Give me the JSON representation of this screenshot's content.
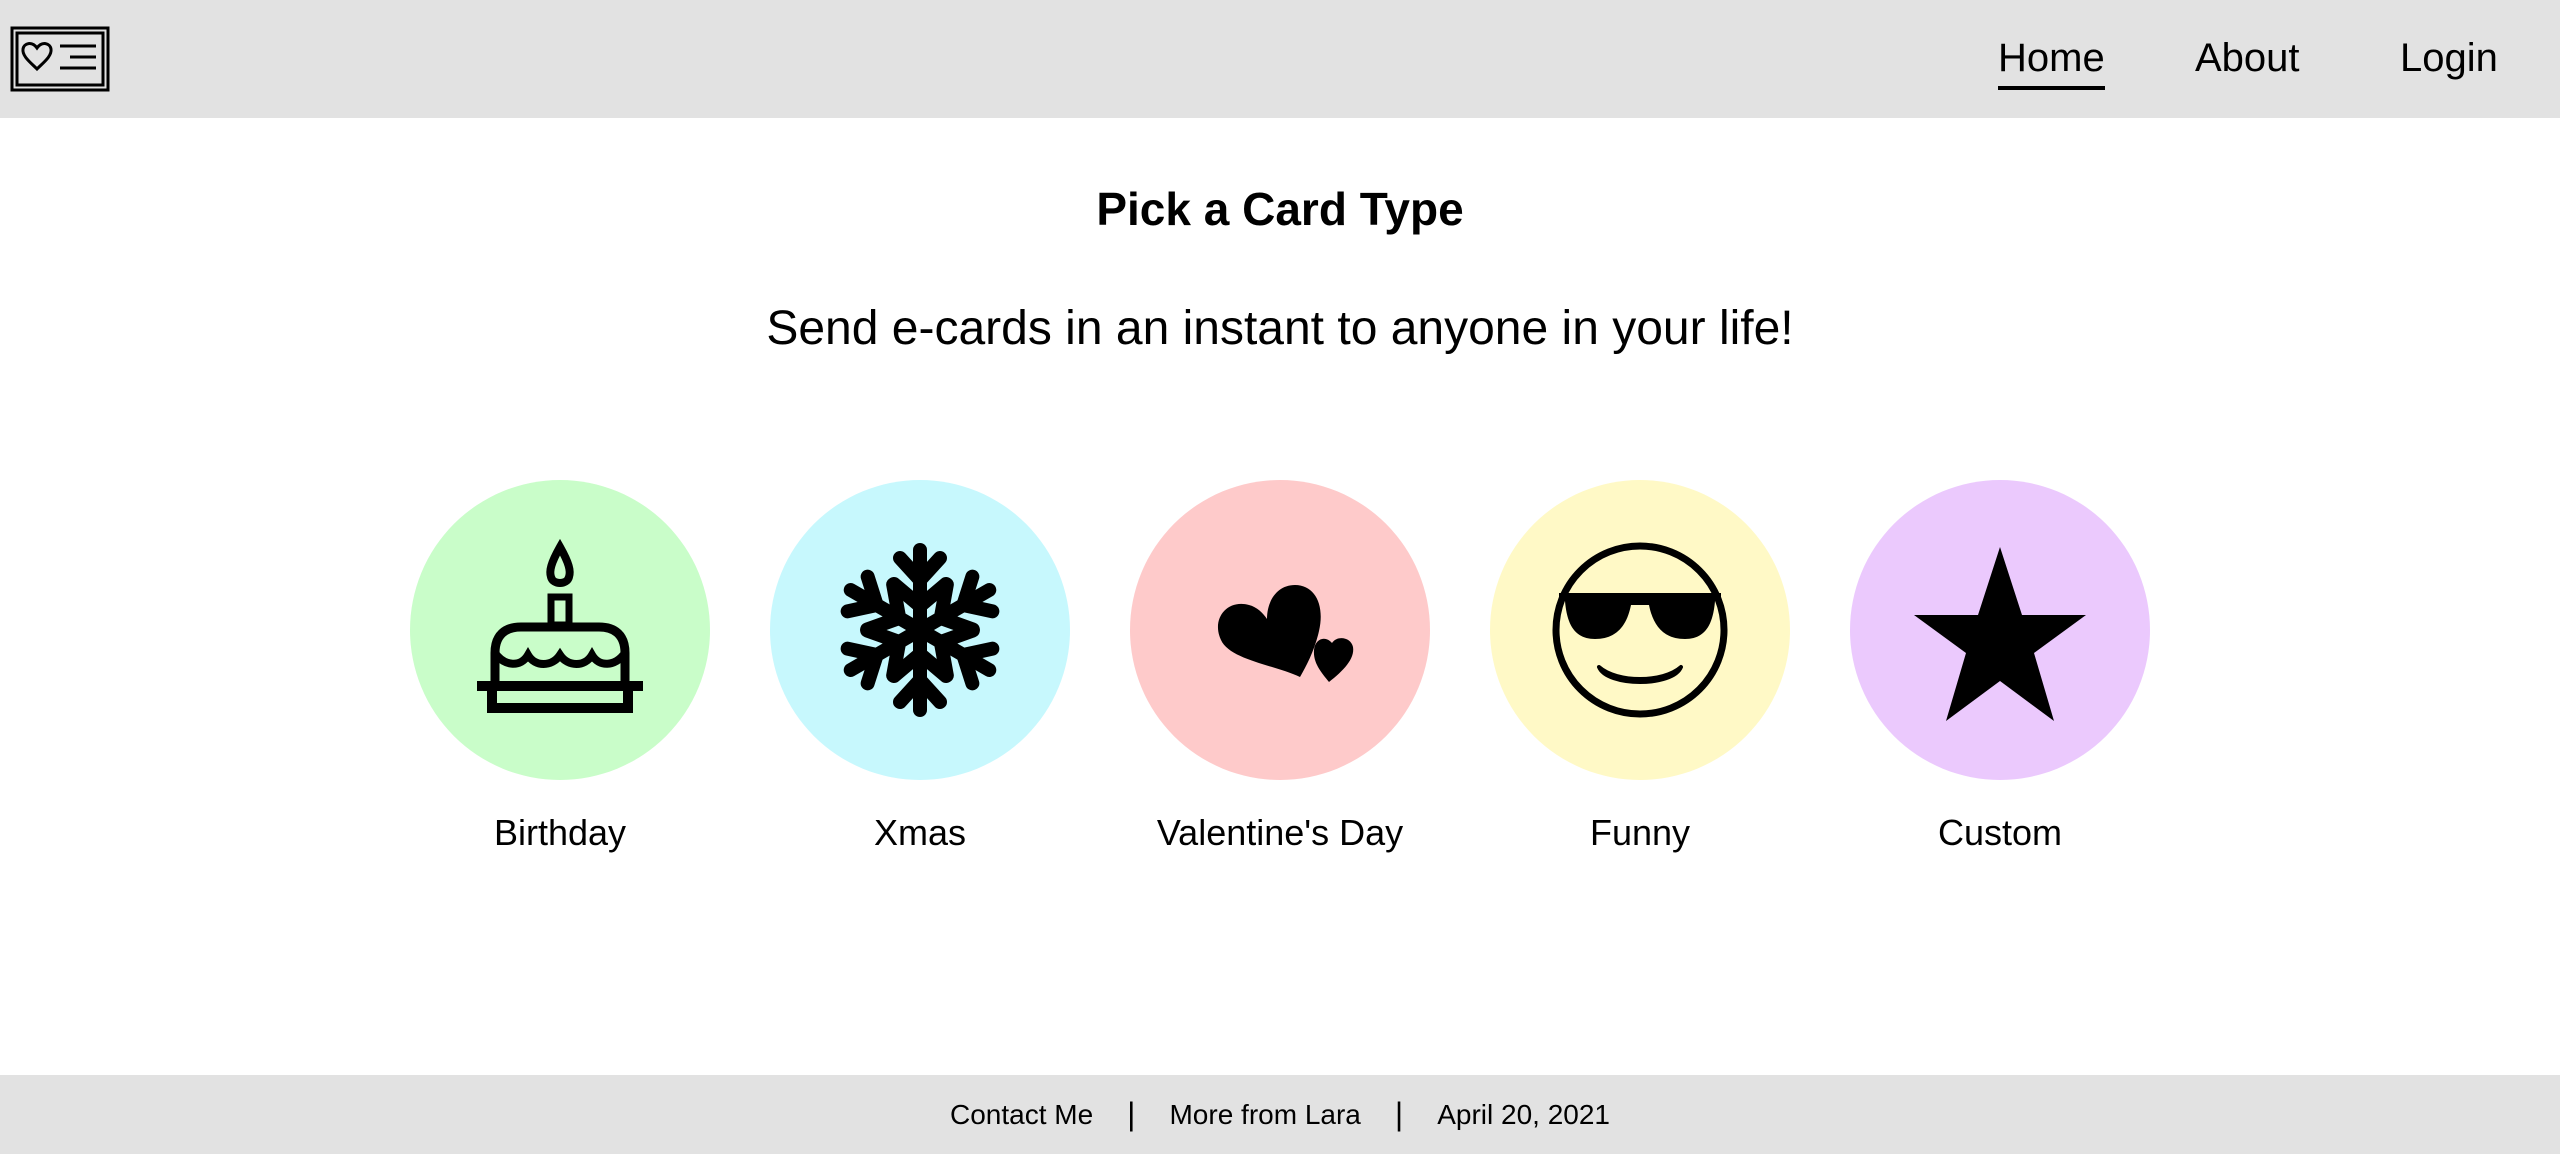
{
  "nav": {
    "logo_icon": "greeting-card-icon",
    "links": [
      {
        "label": "Home",
        "active": true
      },
      {
        "label": "About",
        "active": false
      },
      {
        "label": "Login",
        "active": false
      }
    ]
  },
  "main": {
    "title": "Pick a Card Type",
    "subtitle": "Send e-cards in an instant to anyone in your life!",
    "cards": [
      {
        "label": "Birthday",
        "icon": "birthday-cake-icon",
        "color": "#c9fdc9"
      },
      {
        "label": "Xmas",
        "icon": "snowflake-icon",
        "color": "#c7f8fd"
      },
      {
        "label": "Valentine's Day",
        "icon": "hearts-icon",
        "color": "#fecaca"
      },
      {
        "label": "Funny",
        "icon": "sunglasses-smiley-icon",
        "color": "#fff9c6"
      },
      {
        "label": "Custom",
        "icon": "star-icon",
        "color": "#ebc9fd"
      }
    ]
  },
  "footer": {
    "contact": "Contact Me",
    "separator": "|",
    "more": "More from Lara",
    "date": "April 20, 2021"
  },
  "colors": {
    "header_bg": "#e2e2e2",
    "footer_bg": "#e2e2e2",
    "page_bg": "#ffffff"
  }
}
